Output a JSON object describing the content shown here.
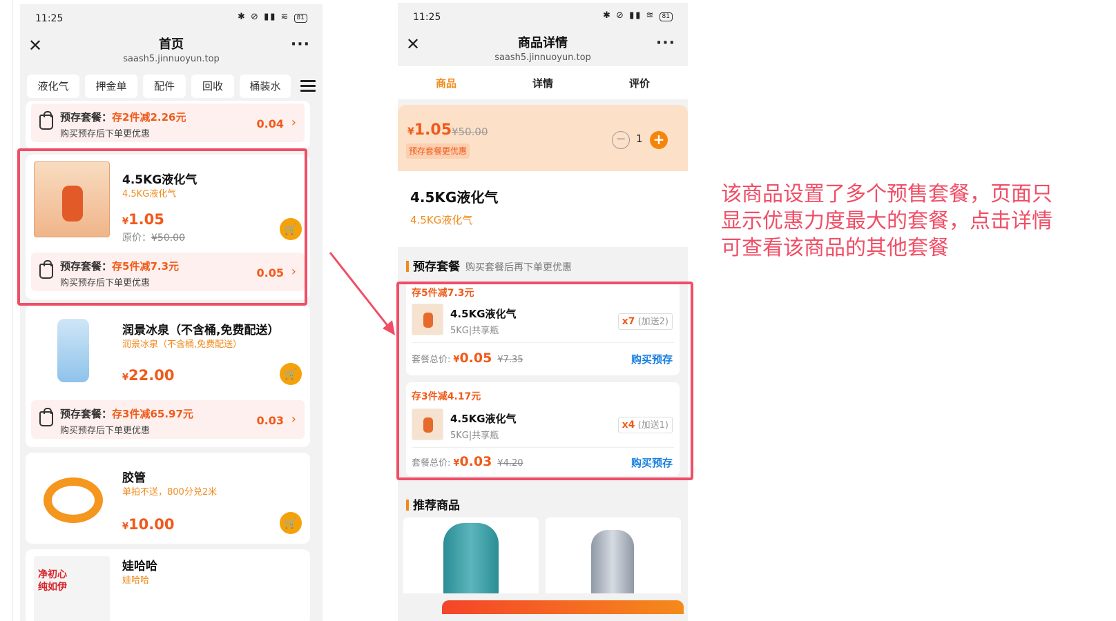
{
  "left_phone": {
    "status": {
      "time": "11:25",
      "battery": "81"
    },
    "nav": {
      "title": "首页",
      "url": "saash5.jinnuoyun.top"
    },
    "categories": [
      "液化气",
      "押金单",
      "配件",
      "回收",
      "桶装水"
    ],
    "top_prestore": {
      "label": "预存套餐：",
      "highlight": "存2件减2.26元",
      "desc": "购买预存后下单更优惠",
      "amount": "0.04"
    },
    "products": [
      {
        "name": "4.5KG液化气",
        "subtitle": "4.5KG液化气",
        "price": "1.05",
        "orig_label": "原价：",
        "orig_price": "¥50.00",
        "prestore": {
          "label": "预存套餐：",
          "highlight": "存5件减7.3元",
          "desc": "购买预存后下单更优惠",
          "amount": "0.05"
        }
      },
      {
        "name": "润景冰泉（不含桶,免费配送）",
        "subtitle": "润景冰泉（不含桶,免费配送）",
        "price": "22.00",
        "prestore": {
          "label": "预存套餐：",
          "highlight": "存3件减65.97元",
          "desc": "购买预存后下单更优惠",
          "amount": "0.03"
        }
      },
      {
        "name": "胶管",
        "subtitle": "单拍不送，800分兑2米",
        "price": "10.00"
      },
      {
        "name": "娃哈哈",
        "subtitle": "娃哈哈",
        "thumb_text": "净初心\n纯如伊"
      }
    ],
    "currency": "¥"
  },
  "right_phone": {
    "status": {
      "time": "11:25",
      "battery": "81"
    },
    "nav": {
      "title": "商品详情",
      "url": "saash5.jinnuoyun.top"
    },
    "tabs": [
      "商品",
      "详情",
      "评价"
    ],
    "price": "1.05",
    "strike_price": "¥50.00",
    "price_tag": "预存套餐更优惠",
    "quantity": "1",
    "product_title": "4.5KG液化气",
    "product_sub": "4.5KG液化气",
    "prestore_section": {
      "title": "预存套餐",
      "note": "购买套餐后再下单更优惠"
    },
    "packages": [
      {
        "title": "存5件减7.3元",
        "name": "4.5KG液化气",
        "spec": "5KG|共享瓶",
        "qty": "x7",
        "bonus": "(加送2)",
        "total_label": "套餐总价:",
        "total": "0.05",
        "orig": "¥7.35",
        "buy": "购买预存"
      },
      {
        "title": "存3件减4.17元",
        "name": "4.5KG液化气",
        "spec": "5KG|共享瓶",
        "qty": "x4",
        "bonus": "(加送1)",
        "total_label": "套餐总价:",
        "total": "0.03",
        "orig": "¥4.20",
        "buy": "购买预存"
      }
    ],
    "recommend_title": "推荐商品",
    "currency": "¥"
  },
  "annotation": "该商品设置了多个预售套餐，页面只显示优惠力度最大的套餐，点击详情可查看该商品的其他套餐",
  "colors": {
    "accent": "#f05a1a",
    "highlight_border": "#f04e66",
    "link": "#1a7fe0"
  }
}
